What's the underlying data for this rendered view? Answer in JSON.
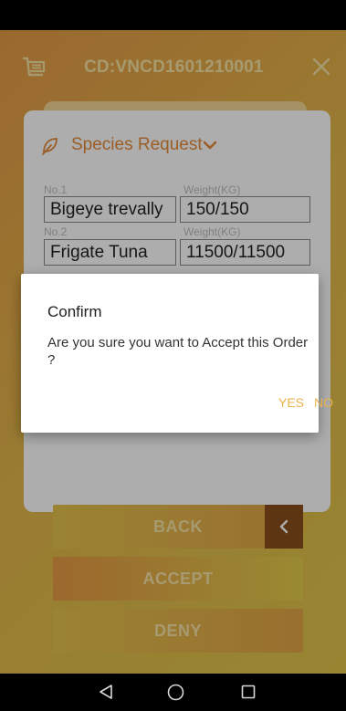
{
  "header": {
    "order_code": "CD:VNCD1601210001",
    "cart_icon": "cart-icon",
    "close_icon": "close-icon"
  },
  "species": {
    "title": "Species Request",
    "icon": "leaf-icon",
    "rows": [
      {
        "no_label": "No.1",
        "weight_label": "Weight(KG)",
        "name": "Bigeye trevally",
        "weight": "150/150"
      },
      {
        "no_label": "No.2",
        "weight_label": "Weight(KG)",
        "name": "Frigate Tuna",
        "weight": "11500/11500"
      }
    ]
  },
  "actions": {
    "back": "BACK",
    "accept": "ACCEPT",
    "deny": "DENY"
  },
  "dialog": {
    "title": "Confirm",
    "message": "Are you sure you want to Accept this Order ?",
    "yes": "YES",
    "no": "NO"
  },
  "colors": {
    "accent": "#e58b3a",
    "dialog_action": "#eab24a",
    "back_arrow_bg": "#8b4f1d"
  }
}
